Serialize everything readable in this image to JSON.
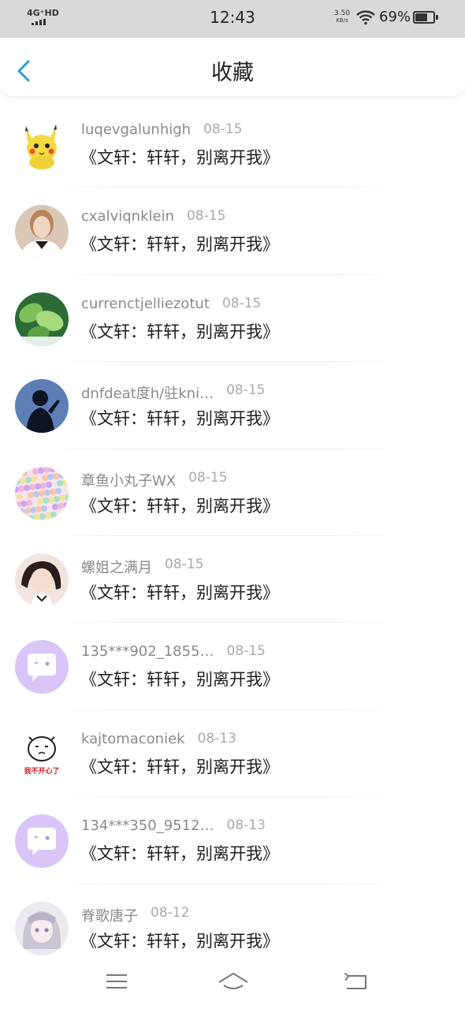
{
  "status_bar": {
    "network": "4G⁺HD",
    "time": "12:43",
    "speed_value": "3.50",
    "speed_unit": "KB/s",
    "battery_percent": "69%",
    "battery_level": 0.69
  },
  "header": {
    "title": "收藏",
    "back_icon": "chevron-left-icon",
    "accent_color": "#2a9be8"
  },
  "favorites": [
    {
      "name": "luqevgalunhigh",
      "date": "08-15",
      "title": "《文轩：轩轩，别离开我》",
      "avatar": "pikachu"
    },
    {
      "name": "cxalviqnklein",
      "date": "08-15",
      "title": "《文轩：轩轩，别离开我》",
      "avatar": "portrait-woman"
    },
    {
      "name": "currenctjelliezotut",
      "date": "08-15",
      "title": "《文轩：轩轩，别离开我》",
      "avatar": "green-leaves"
    },
    {
      "name": "dnfdeat度h/驻kni…",
      "date": "08-15",
      "title": "《文轩：轩轩，别离开我》",
      "avatar": "silhouette"
    },
    {
      "name": "章鱼小丸子WX",
      "date": "08-15",
      "title": "《文轩：轩轩，别离开我》",
      "avatar": "confetti"
    },
    {
      "name": "螺姐之满月",
      "date": "08-15",
      "title": "《文轩：轩轩，别离开我》",
      "avatar": "portrait-girl"
    },
    {
      "name": "135***902_1855…",
      "date": "08-15",
      "title": "《文轩：轩轩，别离开我》",
      "avatar": "default-chat"
    },
    {
      "name": "kajtomaconiek",
      "date": "08-13",
      "title": "《文轩：轩轩，别离开我》",
      "avatar": "sad-face",
      "avatar_caption": "我不开心了"
    },
    {
      "name": "134***350_9512…",
      "date": "08-13",
      "title": "《文轩：轩轩，别离开我》",
      "avatar": "default-chat"
    },
    {
      "name": "脊歌唐子",
      "date": "08-12",
      "title": "《文轩：轩轩，别离开我》",
      "avatar": "anime-girl"
    }
  ],
  "nav_bar": {
    "menu_icon": "menu-icon",
    "home_icon": "home-icon",
    "back_icon": "back-arrow-icon"
  }
}
